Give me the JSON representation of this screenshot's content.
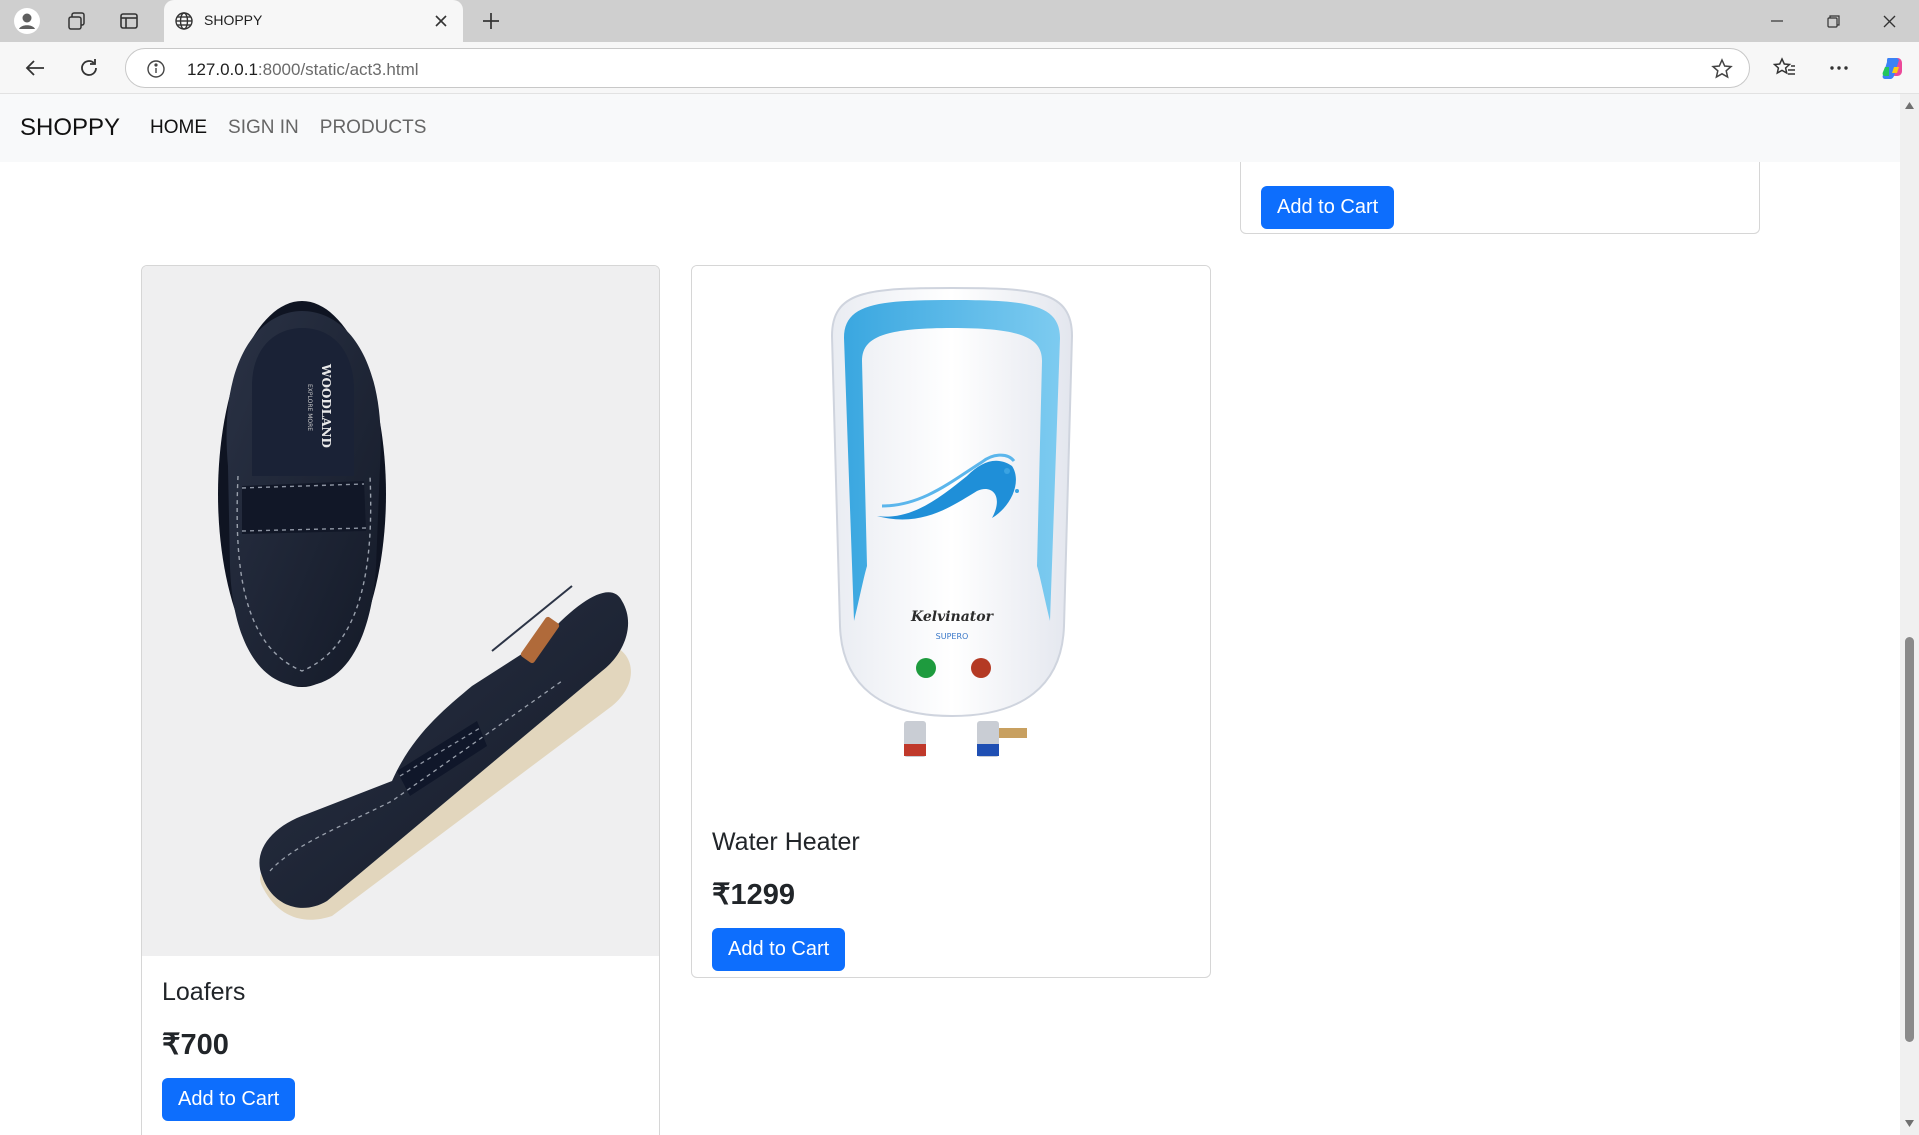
{
  "browser": {
    "tab_title": "SHOPPY",
    "url_host": "127.0.0.1",
    "url_path": ":8000/static/act3.html"
  },
  "site": {
    "brand": "SHOPPY",
    "nav": [
      "HOME",
      "SIGN IN",
      "PRODUCTS"
    ],
    "active_nav": "HOME"
  },
  "products": {
    "top_partial": {
      "button": "Add to Cart"
    },
    "loafers": {
      "name": "Loafers",
      "price": "₹700",
      "button": "Add to Cart",
      "image_brand": "WOODLAND",
      "image_tagline": "EXPLORE MORE"
    },
    "heater": {
      "name": "Water Heater",
      "price": "₹1299",
      "button": "Add to Cart",
      "image_brand": "Kelvinator",
      "image_model": "SUPERO"
    }
  },
  "colors": {
    "primary": "#0d6efd",
    "navbar_bg": "#f8f9fa",
    "chrome_bg": "#cfcfcf"
  }
}
